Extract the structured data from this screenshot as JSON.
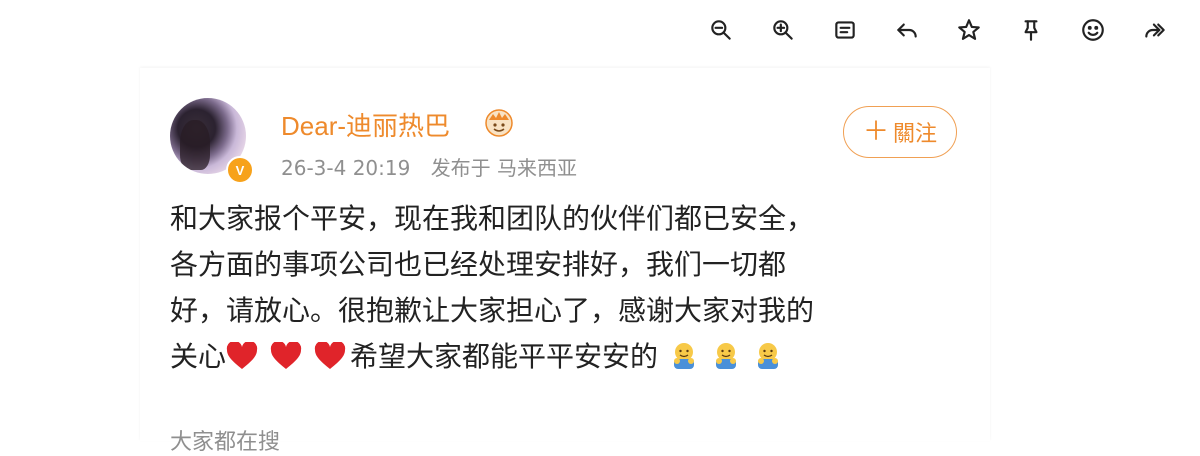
{
  "toolbar": {
    "icons": [
      "zoom-out-icon",
      "zoom-in-icon",
      "reader-mode-icon",
      "reply-icon",
      "favorite-star-icon",
      "pin-icon",
      "emoji-icon",
      "forward-icon"
    ]
  },
  "post": {
    "username": "Dear-迪丽热巴",
    "verified_badge": "V",
    "timestamp": "26-3-4 20:19",
    "location": "发布于 马来西亚",
    "follow_button": "＋關注",
    "follow_plus": "＋",
    "follow_label": "關注",
    "lines": [
      "和大家报个平安，现在我和团队的伙伴们都已安全，",
      "各方面的事项公司也已经处理安排好，我们一切都",
      "好，请放心。很抱歉让大家担心了，感谢大家对我的"
    ],
    "line4_prefix": "关心",
    "line4_text": "希望大家都能平平安安的",
    "footer": "大家都在搜"
  },
  "colors": {
    "accent": "#ee8a2c",
    "muted": "#8f8f8f",
    "text": "#222222",
    "heart": "#e0242a"
  }
}
